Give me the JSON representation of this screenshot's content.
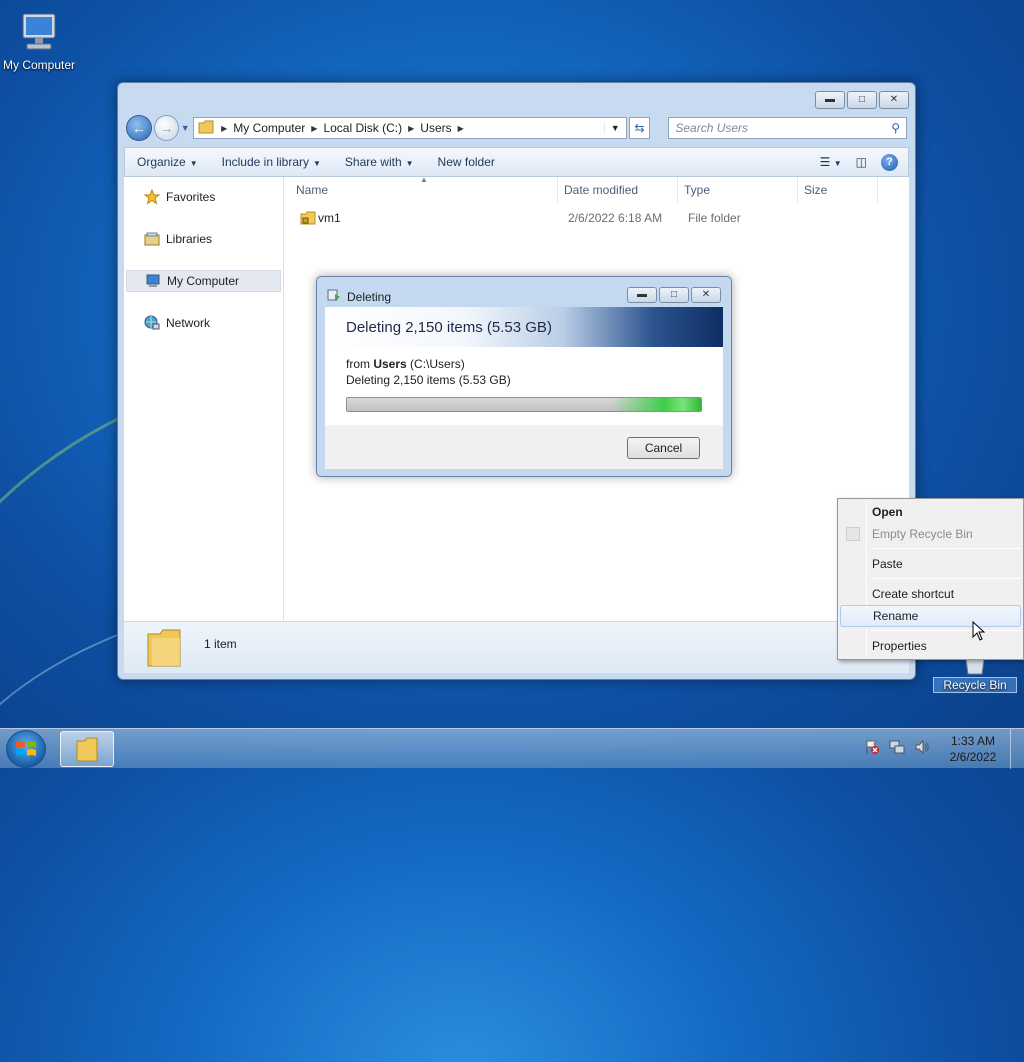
{
  "desktop": {
    "icons": [
      {
        "label": "My Computer",
        "icon": "computer-icon"
      },
      {
        "label": "Recycle Bin",
        "icon": "recycle-bin-icon"
      }
    ]
  },
  "explorer": {
    "breadcrumb": [
      "My Computer",
      "Local Disk (C:)",
      "Users"
    ],
    "search_placeholder": "Search Users",
    "commands": {
      "organize": "Organize",
      "include_in_library": "Include in library",
      "share_with": "Share with",
      "new_folder": "New folder"
    },
    "nav": {
      "favorites": "Favorites",
      "libraries": "Libraries",
      "my_computer": "My Computer",
      "network": "Network"
    },
    "columns": {
      "name": "Name",
      "date_modified": "Date modified",
      "type": "Type",
      "size": "Size"
    },
    "files": [
      {
        "name": "vm1",
        "date_modified": "2/6/2022 6:18 AM",
        "type": "File folder",
        "size": ""
      }
    ],
    "status": {
      "count": "1 item"
    }
  },
  "delete_dialog": {
    "title": "Deleting",
    "heading": "Deleting 2,150 items (5.53 GB)",
    "from_prefix": "from",
    "from_name": "Users",
    "from_path": "(C:\\Users)",
    "detail": "Deleting 2,150 items (5.53 GB)",
    "progress": 1.0,
    "cancel": "Cancel"
  },
  "context_menu": {
    "open": "Open",
    "empty": "Empty Recycle Bin",
    "paste": "Paste",
    "create_shortcut": "Create shortcut",
    "rename": "Rename",
    "properties": "Properties"
  },
  "taskbar": {
    "time": "1:33 AM",
    "date": "2/6/2022"
  },
  "colors": {
    "desktop": "#1469c2",
    "window_frame": "#c7daf0",
    "progress_green": "#3ccf46",
    "menu_hover": "#aecbef"
  }
}
